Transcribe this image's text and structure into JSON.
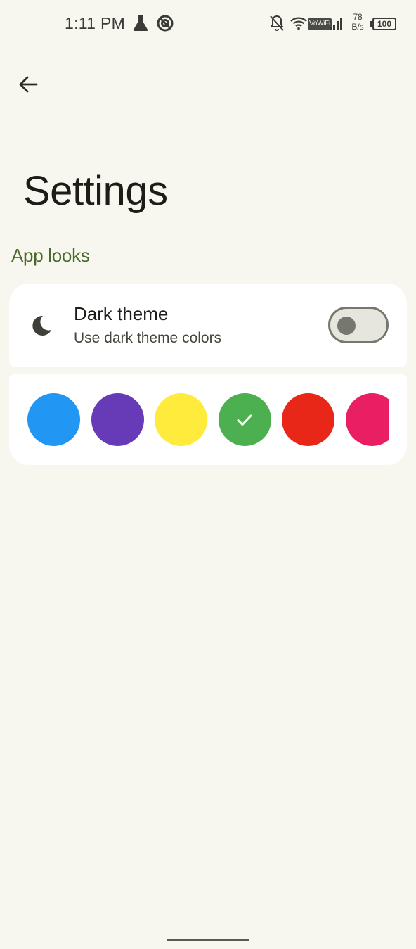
{
  "status_bar": {
    "time": "1:11 PM",
    "vowifi": "VoWiFi",
    "speed_value": "78",
    "speed_unit": "B/s",
    "battery": "100",
    "icons": [
      "lab-flask-icon",
      "sync-icon",
      "bell-off-icon",
      "wifi-icon",
      "signal-icon"
    ]
  },
  "header": {
    "back_icon": "arrow-back-icon",
    "title": "Settings"
  },
  "sections": {
    "app_looks": {
      "header": "App looks",
      "dark_theme": {
        "icon": "moon-icon",
        "title": "Dark theme",
        "subtitle": "Use dark theme colors",
        "enabled": false
      },
      "color_swatches": [
        {
          "name": "blue",
          "color": "#2196f3",
          "selected": false
        },
        {
          "name": "purple",
          "color": "#673ab7",
          "selected": false
        },
        {
          "name": "yellow",
          "color": "#ffeb3b",
          "selected": false
        },
        {
          "name": "green",
          "color": "#4caf50",
          "selected": true
        },
        {
          "name": "red",
          "color": "#e82718",
          "selected": false
        },
        {
          "name": "pink",
          "color": "#e91e63",
          "selected": false
        }
      ]
    }
  },
  "colors": {
    "background": "#f7f7f0",
    "accent": "#4a6a28",
    "card": "#ffffff"
  }
}
